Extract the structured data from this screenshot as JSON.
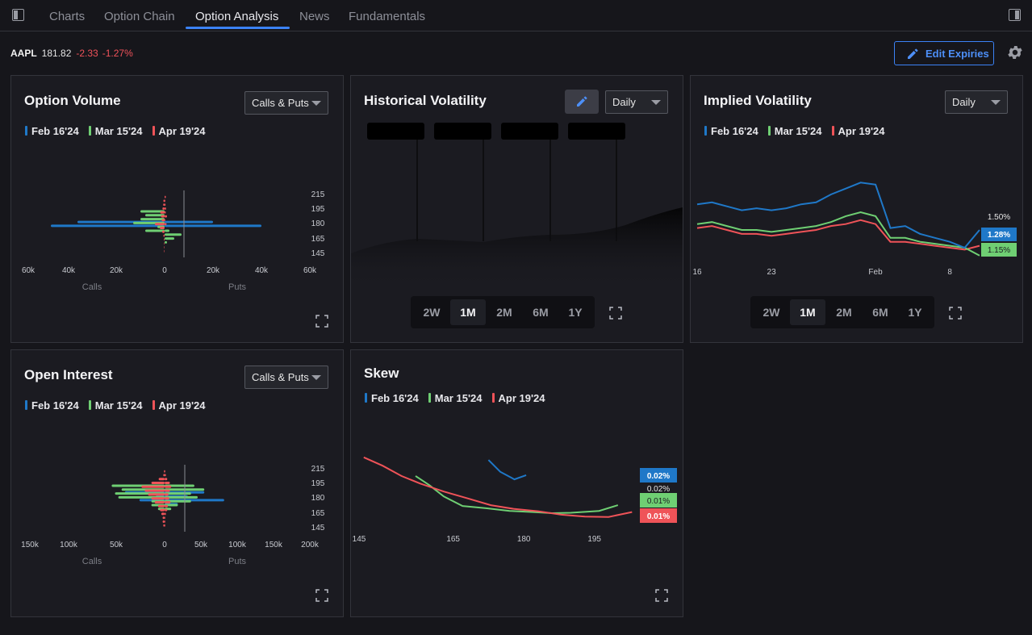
{
  "tabs": [
    {
      "label": "Charts",
      "active": false
    },
    {
      "label": "Option Chain",
      "active": false
    },
    {
      "label": "Option Analysis",
      "active": true
    },
    {
      "label": "News",
      "active": false
    },
    {
      "label": "Fundamentals",
      "active": false
    }
  ],
  "quote": {
    "symbol": "AAPL",
    "price": "181.82",
    "change": "-2.33",
    "change_pct": "-1.27%"
  },
  "toolbar": {
    "edit_expiries": "Edit Expiries"
  },
  "colors": {
    "feb": "#1f78c8",
    "mar": "#6fcf73",
    "apr": "#ef5358",
    "accent": "#3b82f6",
    "negative": "#f0525a"
  },
  "legend": [
    {
      "label": "Feb 16'24",
      "color": "#1f78c8"
    },
    {
      "label": "Mar 15'24",
      "color": "#6fcf73"
    },
    {
      "label": "Apr 19'24",
      "color": "#ef5358"
    }
  ],
  "option_volume": {
    "title": "Option Volume",
    "filter": "Calls & Puts",
    "y_ticks": [
      "215",
      "195",
      "180",
      "165",
      "145"
    ],
    "x_ticks": [
      "60k",
      "40k",
      "20k",
      "0",
      "20k",
      "40k",
      "60k"
    ],
    "calls_label": "Calls",
    "puts_label": "Puts"
  },
  "open_interest": {
    "title": "Open Interest",
    "filter": "Calls & Puts",
    "y_ticks": [
      "215",
      "195",
      "180",
      "165",
      "145"
    ],
    "x_ticks": [
      "150k",
      "100k",
      "50k",
      "0",
      "50k",
      "100k",
      "150k",
      "200k"
    ],
    "calls_label": "Calls",
    "puts_label": "Puts"
  },
  "historical_volatility": {
    "title": "Historical Volatility",
    "interval": "Daily",
    "ranges": [
      "2W",
      "1M",
      "2M",
      "6M",
      "1Y"
    ],
    "active_range": "1M"
  },
  "implied_volatility": {
    "title": "Implied Volatility",
    "interval": "Daily",
    "ranges": [
      "2W",
      "1M",
      "2M",
      "6M",
      "1Y"
    ],
    "active_range": "1M",
    "x_ticks": [
      "16",
      "23",
      "Feb",
      "8"
    ],
    "labels": {
      "top": "1.50%",
      "feb": "1.28%",
      "mar": "1.15%"
    }
  },
  "skew": {
    "title": "Skew",
    "x_ticks": [
      "145",
      "165",
      "180",
      "195"
    ],
    "labels": {
      "feb": "0.02%",
      "mid": "0.02%",
      "mar": "0.01%",
      "apr": "0.01%"
    }
  },
  "chart_data": [
    {
      "type": "line",
      "title": "Implied Volatility",
      "x": [
        "16",
        "17",
        "18",
        "19",
        "22",
        "23",
        "24",
        "25",
        "26",
        "29",
        "30",
        "31",
        "Feb 1",
        "2",
        "5",
        "6",
        "7",
        "8",
        "9",
        "12"
      ],
      "series": [
        {
          "name": "Feb 16'24",
          "values": [
            1.41,
            1.42,
            1.4,
            1.38,
            1.39,
            1.38,
            1.39,
            1.41,
            1.42,
            1.46,
            1.49,
            1.52,
            1.51,
            1.29,
            1.3,
            1.26,
            1.24,
            1.22,
            1.19,
            1.28
          ]
        },
        {
          "name": "Mar 15'24",
          "values": [
            1.31,
            1.32,
            1.3,
            1.28,
            1.28,
            1.27,
            1.28,
            1.29,
            1.3,
            1.32,
            1.35,
            1.37,
            1.35,
            1.24,
            1.24,
            1.22,
            1.21,
            1.2,
            1.19,
            1.15
          ]
        },
        {
          "name": "Apr 19'24",
          "values": [
            1.29,
            1.3,
            1.28,
            1.26,
            1.26,
            1.25,
            1.26,
            1.27,
            1.28,
            1.3,
            1.31,
            1.33,
            1.31,
            1.22,
            1.22,
            1.21,
            1.2,
            1.19,
            1.18,
            1.2
          ]
        }
      ]
    },
    {
      "type": "line",
      "title": "Skew",
      "x_range": [
        145,
        205
      ],
      "series": [
        {
          "name": "Feb 16'24",
          "x": [
            172.5,
            175,
            178,
            180.5
          ],
          "values": [
            0.0287,
            0.0256,
            0.0236,
            0.0247
          ]
        },
        {
          "name": "Mar 15'24",
          "x": [
            157,
            160,
            163,
            167,
            172,
            177,
            182,
            186,
            190,
            196,
            200
          ],
          "values": [
            0.0245,
            0.022,
            0.0191,
            0.0166,
            0.016,
            0.0153,
            0.015,
            0.0147,
            0.0148,
            0.0153,
            0.0168
          ]
        },
        {
          "name": "Apr 19'24",
          "x": [
            146,
            150,
            154,
            158,
            163,
            168,
            173,
            178,
            183,
            188,
            193,
            198,
            203
          ],
          "values": [
            0.0294,
            0.0272,
            0.0245,
            0.0225,
            0.0204,
            0.0186,
            0.0168,
            0.0158,
            0.0152,
            0.0143,
            0.0138,
            0.0137,
            0.015
          ]
        }
      ]
    },
    {
      "type": "bar",
      "title": "Option Volume",
      "orientation": "horizontal",
      "strikes": [
        215,
        210,
        205,
        200,
        195,
        190,
        185,
        180,
        175,
        170,
        165,
        160,
        155,
        150,
        145
      ],
      "series": [
        {
          "name": "Feb 16'24",
          "calls": [
            0,
            0,
            0,
            0,
            0,
            0,
            0,
            36000,
            47000,
            0,
            0,
            0,
            0,
            0,
            0
          ],
          "puts": [
            0,
            0,
            0,
            0,
            0,
            0,
            0,
            20000,
            40000,
            0,
            0,
            0,
            0,
            0,
            0
          ]
        },
        {
          "name": "Mar 15'24",
          "calls": [
            0,
            0,
            0,
            0,
            10000,
            8000,
            10000,
            13000,
            3000,
            8000,
            0,
            0,
            0,
            0,
            0
          ],
          "puts": [
            0,
            0,
            0,
            0,
            0,
            0,
            0,
            0,
            0,
            2000,
            7000,
            4000,
            1000,
            0,
            0
          ]
        },
        {
          "name": "Apr 19'24",
          "calls": [
            0,
            500,
            600,
            900,
            1800,
            1500,
            1200,
            4000,
            2000,
            1000,
            500,
            300,
            200,
            200,
            200
          ],
          "puts": [
            500,
            300,
            400,
            600,
            500,
            1000,
            300,
            800,
            0,
            0,
            0,
            0,
            0,
            0,
            0
          ]
        }
      ]
    },
    {
      "type": "bar",
      "title": "Open Interest",
      "orientation": "horizontal",
      "strikes": [
        215,
        210,
        205,
        200,
        195,
        190,
        185,
        180,
        175,
        170,
        165,
        160,
        155,
        150,
        145
      ],
      "series": [
        {
          "name": "Feb 16'24",
          "calls": [
            0,
            0,
            0,
            0,
            0,
            0,
            60000,
            13000,
            38000,
            0,
            0,
            0,
            0,
            0,
            0
          ],
          "puts": [
            0,
            0,
            0,
            0,
            0,
            0,
            60000,
            35000,
            90000,
            20000,
            0,
            0,
            0,
            0,
            0
          ],
          "mid": [
            0,
            0,
            0,
            0,
            0,
            0,
            0,
            0,
            0,
            0,
            0,
            0,
            0,
            0,
            0
          ]
        },
        {
          "name": "Mar 15'24",
          "calls": [
            0,
            0,
            0,
            0,
            80000,
            65000,
            75000,
            70000,
            20000,
            20000,
            10000,
            0,
            0,
            0,
            0
          ],
          "puts": [
            0,
            0,
            0,
            0,
            45000,
            60000,
            40000,
            50000,
            40000,
            20000,
            10000,
            0,
            0,
            0,
            0
          ]
        },
        {
          "name": "Apr 19'24",
          "calls": [
            1000,
            2000,
            9000,
            20000,
            35000,
            30000,
            25000,
            20000,
            15000,
            10000,
            7000,
            5000,
            3000,
            3000,
            2000
          ],
          "puts": [
            1000,
            2000,
            4000,
            8000,
            10000,
            8000,
            6000,
            7000,
            9000,
            5000,
            4000,
            2000,
            1000,
            1000,
            1000
          ]
        }
      ]
    }
  ]
}
